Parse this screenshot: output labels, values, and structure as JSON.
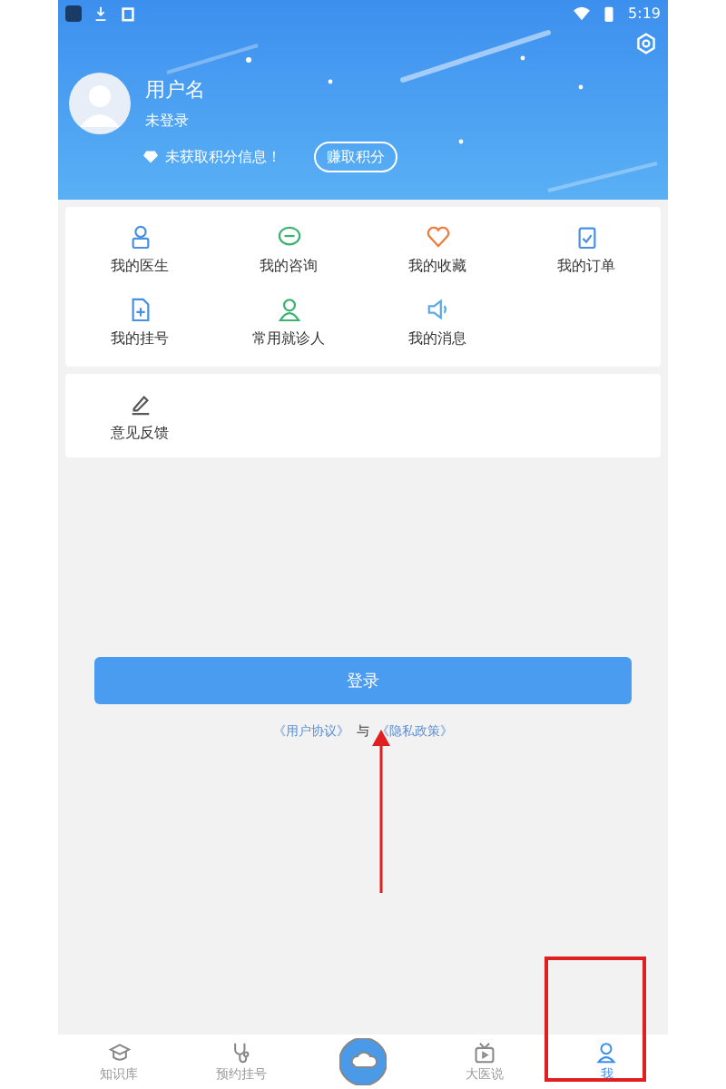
{
  "status_bar": {
    "time": "5:19"
  },
  "profile": {
    "username": "用户名",
    "status": "未登录",
    "points_text": "未获取积分信息！",
    "earn_button": "赚取积分"
  },
  "menu": [
    {
      "label": "我的医生",
      "kind": "doctor"
    },
    {
      "label": "我的咨询",
      "kind": "chat"
    },
    {
      "label": "我的收藏",
      "kind": "heart"
    },
    {
      "label": "我的订单",
      "kind": "clipboard"
    },
    {
      "label": "我的挂号",
      "kind": "register"
    },
    {
      "label": "常用就诊人",
      "kind": "person"
    },
    {
      "label": "我的消息",
      "kind": "speaker"
    }
  ],
  "feedback": {
    "label": "意见反馈"
  },
  "login": {
    "button": "登录",
    "user_agreement": "《用户协议》",
    "joiner": "与",
    "privacy_policy": "《隐私政策》"
  },
  "tabs": [
    {
      "label": "知识库",
      "kind": "cap",
      "selected": false
    },
    {
      "label": "预约挂号",
      "kind": "stethoscope",
      "selected": false
    },
    {
      "kind": "center",
      "selected": false
    },
    {
      "label": "大医说",
      "kind": "tv",
      "selected": false
    },
    {
      "label": "我",
      "kind": "user",
      "selected": true
    }
  ]
}
